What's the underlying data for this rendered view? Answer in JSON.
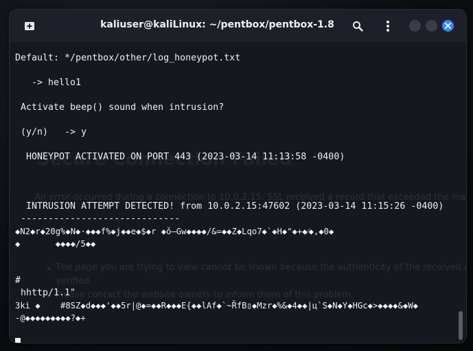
{
  "window": {
    "title": "kaliuser@kaliLinux: ~/pentbox/pentbox-1.8"
  },
  "icons": {
    "new_tab": "new-tab-icon",
    "search": "search-icon",
    "menu": "vertical-ellipsis-icon",
    "minimize": "minimize-icon",
    "maximize": "maximize-icon",
    "close": "close-icon"
  },
  "colors": {
    "close_button": "#3b82f6",
    "terminal_bg": "#16181f",
    "terminal_text": "#eef0f2"
  },
  "terminal": {
    "lines": [
      "Default: */pentbox/other/log_honeypot.txt",
      "   -> hello1",
      " Activate beep() sound when intrusion?",
      " (y/n)   -> y",
      "  HONEYPOT ACTIVATED ON PORT 443 (2023-03-14 11:13:58 -0400)",
      "  INTRUSION ATTEMPT DETECTED! from 10.0.2.15:47602 (2023-03-14 11:15:26 -0400)",
      " -----------------------------",
      "◆N2◆r◆20g%◆N◆·◆◆◆f%◆j◆◆e◆$◆r ◆ǒ–Gw◆◆◆◆/&=◆◆Z◆Lqo7◆`◆H◆\"◆+◆⁄◆,◆0◆",
      "◆       ◆◆◆◆/5◆◆",
      "#",
      " hhttp/1.1\"",
      "3ki ◆    #8SZ◆d◆◆◆'◆◆5r|@◆=◆◆R◆◆◆E{◆◆lAf◆`~R̄fB▯◆Mzr◆%&◆4◆◆|ц`S◆N◆Y◆HGc◆>◆◆◆◆&◆W◆",
      "-@◆◆◆◆◆◆◆◆◆?◆+"
    ],
    "background_text": {
      "heading": "Secure Connection Failed",
      "error": "An error occurred during a connection to 10.0.2.15. SSL received a record that exceeded the maxim",
      "bullet1": "The page you are trying to view cannot be shown because the authenticity of the received da",
      "bullet1_cont": "verified.",
      "bullet2": "Please contact the website owners to inform them of this problem."
    }
  }
}
